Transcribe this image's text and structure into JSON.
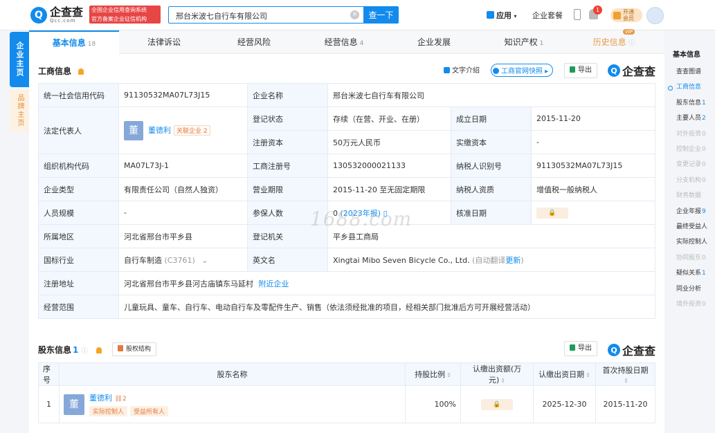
{
  "header": {
    "logo_mark": "Q",
    "logo_cn": "企查查",
    "logo_en": "Qcc.com",
    "badge_line1": "全国企业信用查询系统",
    "badge_line2": "官方备案企业征信机构",
    "search_value": "邢台米波七自行车有限公司",
    "search_button": "查一下",
    "nav_app": "应用",
    "nav_package": "企业套餐",
    "bell_count": "1",
    "vip_line1": "开通",
    "vip_line2": "会员"
  },
  "left_tabs": {
    "company": "企业主页",
    "brand": "品牌主页"
  },
  "tabs": [
    {
      "label": "基本信息",
      "count": "18"
    },
    {
      "label": "法律诉讼",
      "count": ""
    },
    {
      "label": "经营风险",
      "count": ""
    },
    {
      "label": "经营信息",
      "count": "4"
    },
    {
      "label": "企业发展",
      "count": ""
    },
    {
      "label": "知识产权",
      "count": "1"
    },
    {
      "label": "历史信息",
      "count": ""
    }
  ],
  "vip_tag": "VIP",
  "business": {
    "title": "工商信息",
    "text_intro": "文字介绍",
    "snapshot": "工商官网快照",
    "export": "导出",
    "brand": "企查查",
    "rows": {
      "credit_code_label": "统一社会信用代码",
      "credit_code": "91130532MA07L73J15",
      "name_label": "企业名称",
      "name": "邢台米波七自行车有限公司",
      "legal_label": "法定代表人",
      "legal_avatar": "董",
      "legal_name": "董德利",
      "legal_related": "关联企业 2",
      "status_label": "登记状态",
      "status": "存续（在营、开业、在册）",
      "found_label": "成立日期",
      "found": "2015-11-20",
      "capital_label": "注册资本",
      "capital": "50万元人民币",
      "paid_label": "实缴资本",
      "paid": "-",
      "org_label": "组织机构代码",
      "org": "MA07L73J-1",
      "reg_no_label": "工商注册号",
      "reg_no": "130532000021133",
      "tax_label": "纳税人识别号",
      "tax": "91130532MA07L73J15",
      "type_label": "企业类型",
      "type": "有限责任公司（自然人独资）",
      "term_label": "营业期限",
      "term": "2015-11-20 至无固定期限",
      "taxq_label": "纳税人资质",
      "taxq": "增值税一般纳税人",
      "staff_label": "人员规模",
      "staff": "-",
      "insured_label": "参保人数",
      "insured": "0",
      "insured_year": "(2023年报)",
      "approve_label": "核准日期",
      "region_label": "所属地区",
      "region": "河北省邢台市平乡县",
      "authority_label": "登记机关",
      "authority": "平乡县工商局",
      "industry_label": "国标行业",
      "industry": "自行车制造",
      "industry_code": "(C3761)",
      "en_label": "英文名",
      "en_name": "Xingtai Mibo Seven Bicycle Co., Ltd.",
      "en_auto": "(自动翻译",
      "en_update": "更新",
      "en_close": ")",
      "addr_label": "注册地址",
      "addr": "河北省邢台市平乡县河古庙镇东马延村",
      "nearby": "附近企业",
      "scope_label": "经营范围",
      "scope": "儿童玩具、童车、自行车、电动自行车及零配件生产、销售（依法须经批准的项目，经相关部门批准后方可开展经营活动）"
    }
  },
  "watermark": "1688.com",
  "shareholders": {
    "title": "股东信息",
    "count": "1",
    "structure": "股权结构",
    "export": "导出",
    "brand": "企查查",
    "headers": {
      "no": "序号",
      "name": "股东名称",
      "ratio": "持股比例",
      "amount": "认缴出资额(万元)",
      "date": "认缴出资日期",
      "first": "首次持股日期"
    },
    "row": {
      "no": "1",
      "avatar": "董",
      "name": "董德利",
      "related": "2",
      "tag1": "实际控制人",
      "tag2": "受益所有人",
      "ratio": "100%",
      "date": "2025-12-30",
      "first": "2015-11-20"
    }
  },
  "right_nav": {
    "head": "基本信息",
    "items": [
      {
        "label": "查查图谱",
        "n": "",
        "state": "normal"
      },
      {
        "label": "工商信息",
        "n": "",
        "state": "active"
      },
      {
        "label": "股东信息",
        "n": "1",
        "state": "normal"
      },
      {
        "label": "主要人员",
        "n": "2",
        "state": "normal"
      },
      {
        "label": "对外投资",
        "n": "0",
        "state": "dis"
      },
      {
        "label": "控制企业",
        "n": "0",
        "state": "dis"
      },
      {
        "label": "变更记录",
        "n": "0",
        "state": "dis"
      },
      {
        "label": "分支机构",
        "n": "0",
        "state": "dis"
      },
      {
        "label": "财务数据",
        "n": "",
        "state": "dis"
      },
      {
        "label": "企业年报",
        "n": "9",
        "state": "normal"
      },
      {
        "label": "最终受益人",
        "n": "",
        "state": "normal"
      },
      {
        "label": "实际控制人",
        "n": "",
        "state": "normal"
      },
      {
        "label": "协同股东",
        "n": "0",
        "state": "dis"
      },
      {
        "label": "疑似关系",
        "n": "1",
        "state": "normal"
      },
      {
        "label": "同业分析",
        "n": "",
        "state": "normal"
      },
      {
        "label": "境外投资",
        "n": "0",
        "state": "dis"
      }
    ]
  }
}
